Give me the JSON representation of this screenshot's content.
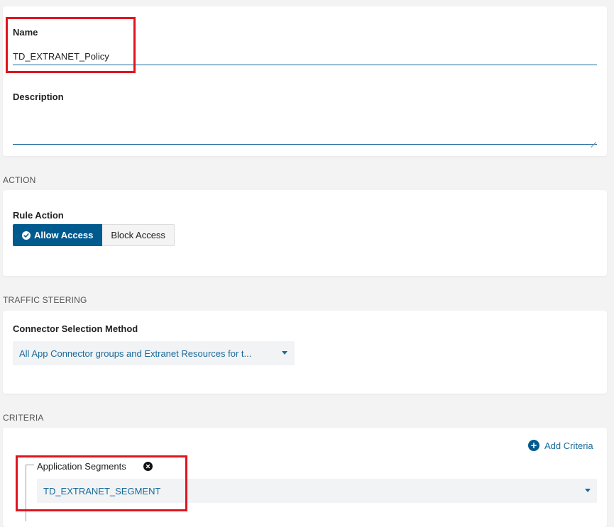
{
  "general": {
    "name_label": "Name",
    "name_value": "TD_EXTRANET_Policy",
    "description_label": "Description",
    "description_value": ""
  },
  "action": {
    "section_title": "ACTION",
    "rule_action_label": "Rule Action",
    "allow_label": "Allow Access",
    "block_label": "Block Access",
    "selected": "Allow Access"
  },
  "traffic_steering": {
    "section_title": "TRAFFIC STEERING",
    "method_label": "Connector Selection Method",
    "method_value": "All App Connector groups and Extranet Resources for t..."
  },
  "criteria": {
    "section_title": "CRITERIA",
    "add_label": "Add Criteria",
    "segments_label": "Application Segments",
    "segments_value": "TD_EXTRANET_SEGMENT"
  },
  "colors": {
    "accent": "#005a8e",
    "link": "#1a6a9a",
    "highlight": "#e0141e",
    "page_bg": "#f3f3f3"
  },
  "icons": {
    "allow": "check-circle-icon",
    "add": "plus-circle-icon",
    "remove": "close-circle-icon",
    "dropdown": "caret-down-icon"
  }
}
